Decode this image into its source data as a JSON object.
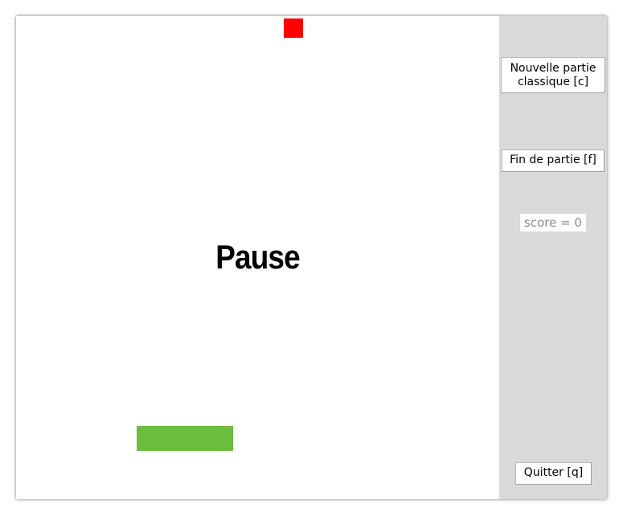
{
  "game": {
    "status_text": "Pause",
    "ball_color": "#ff0000",
    "paddle_color": "#6bbd3e"
  },
  "controls": {
    "new_game_label": "Nouvelle partie\nclassique [c]",
    "end_game_label": "Fin de partie [f]",
    "quit_label": "Quitter [q]"
  },
  "score": {
    "label": "score = 0"
  }
}
